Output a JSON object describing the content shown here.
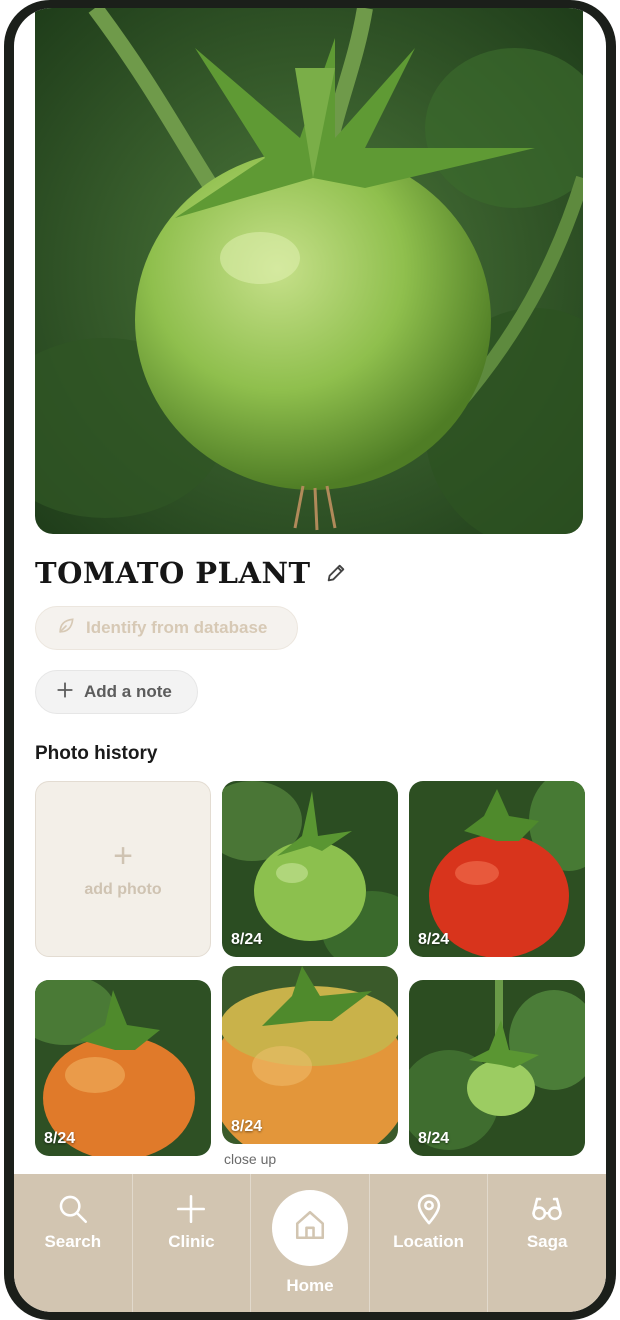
{
  "plant": {
    "title": "TOMATO PLANT",
    "identify_label": "Identify from database",
    "add_note_label": "Add a note"
  },
  "photo_history": {
    "title": "Photo history",
    "add_photo_label": "add photo",
    "photos": [
      {
        "date": "8/24",
        "caption": ""
      },
      {
        "date": "8/24",
        "caption": ""
      },
      {
        "date": "8/24",
        "caption": ""
      },
      {
        "date": "8/24",
        "caption": "close up"
      },
      {
        "date": "8/24",
        "caption": ""
      }
    ]
  },
  "nav": {
    "items": [
      {
        "label": "Search",
        "icon": "search-icon"
      },
      {
        "label": "Clinic",
        "icon": "plus-icon"
      },
      {
        "label": "Home",
        "icon": "home-icon"
      },
      {
        "label": "Location",
        "icon": "location-pin-icon"
      },
      {
        "label": "Saga",
        "icon": "glasses-icon"
      }
    ]
  },
  "colors": {
    "nav_bg": "#d2c5b1",
    "add_tile_bg": "#f3efe8",
    "identify_text": "#d7c9b5"
  }
}
